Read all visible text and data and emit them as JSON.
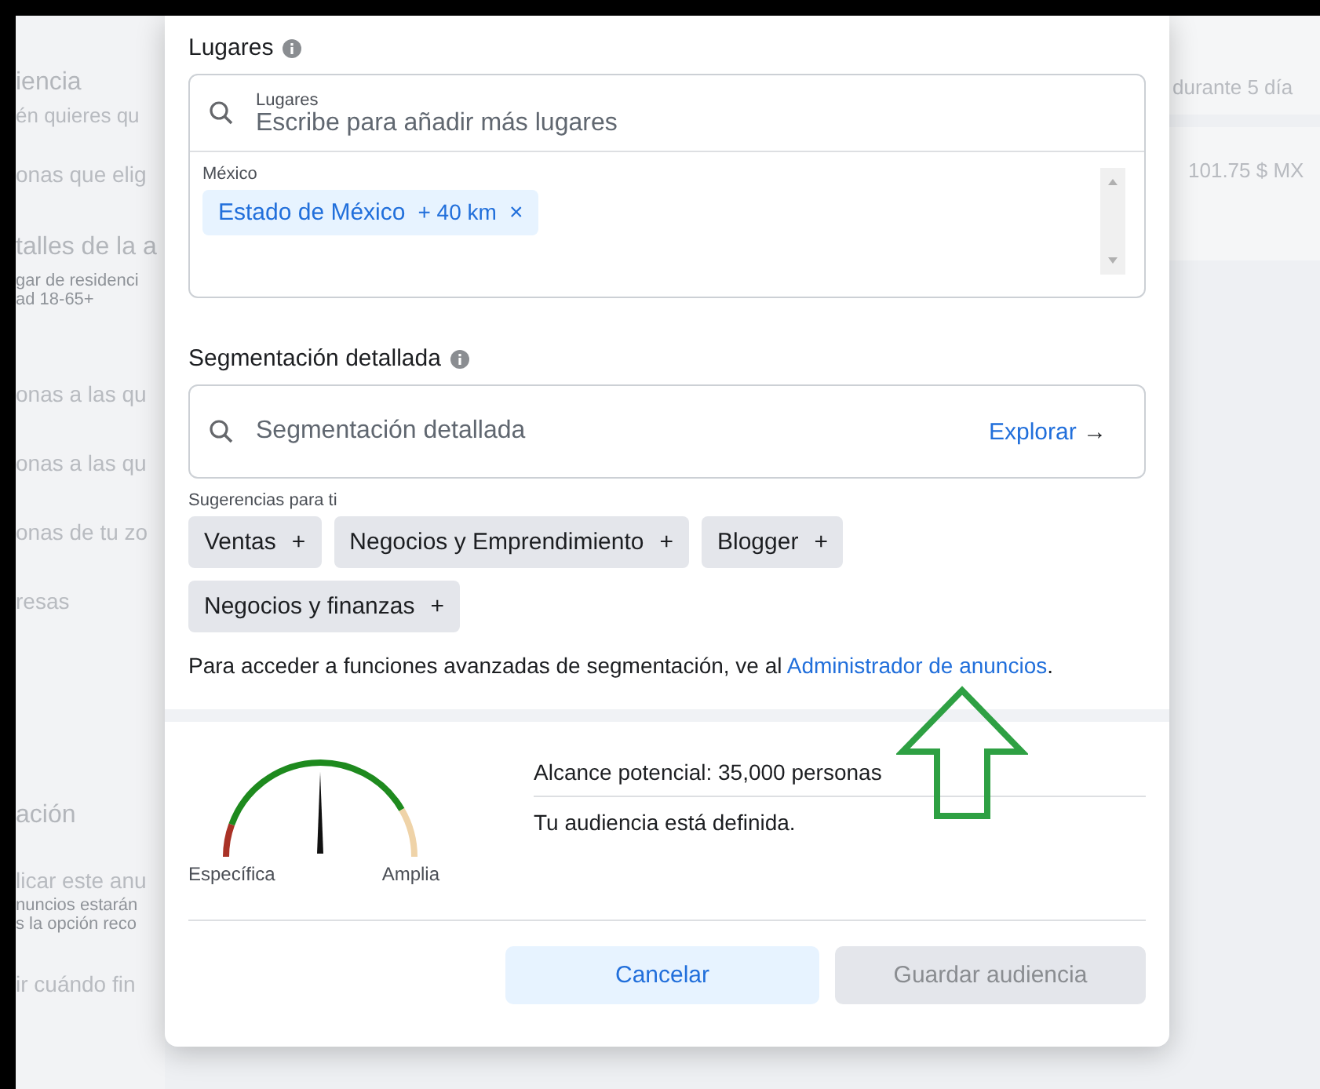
{
  "background": {
    "left_texts": [
      {
        "text": "iencia",
        "kind": "heading"
      },
      {
        "text": "én quieres qu",
        "kind": "sub"
      },
      {
        "text": "onas que elig",
        "kind": "row"
      },
      {
        "text": "talles de la a",
        "kind": "heading"
      },
      {
        "text": "gar de residenci",
        "kind": "small"
      },
      {
        "text": "ad 18-65+",
        "kind": "small"
      },
      {
        "text": "onas a las qu",
        "kind": "row"
      },
      {
        "text": "onas a las qu",
        "kind": "row"
      },
      {
        "text": "onas de tu zo",
        "kind": "row"
      },
      {
        "text": "resas",
        "kind": "row"
      },
      {
        "text": "ación",
        "kind": "heading"
      },
      {
        "text": "licar este anu",
        "kind": "row"
      },
      {
        "text": "nuncios estarán",
        "kind": "small"
      },
      {
        "text": "s la opción reco",
        "kind": "small"
      },
      {
        "text": "ir cuándo fin",
        "kind": "row"
      }
    ],
    "right_texts": [
      "durante 5 día",
      "101.75 $ MX"
    ]
  },
  "modal": {
    "places": {
      "title": "Lugares",
      "field_label": "Lugares",
      "placeholder": "Escribe para añadir más lugares",
      "country": "México",
      "chips": [
        {
          "label": "Estado de México",
          "radius": "+ 40 km",
          "remove": "×"
        }
      ]
    },
    "detailed": {
      "title": "Segmentación detallada",
      "placeholder": "Segmentación detallada",
      "explore": "Explorar",
      "explore_arrow": "→"
    },
    "suggestions": {
      "title": "Sugerencias para ti",
      "chips": [
        {
          "label": "Ventas",
          "add": "+"
        },
        {
          "label": "Negocios y Emprendimiento",
          "add": "+"
        },
        {
          "label": "Blogger",
          "add": "+"
        },
        {
          "label": "Negocios y finanzas",
          "add": "+"
        }
      ]
    },
    "note": {
      "text": "Para acceder a funciones avanzadas de segmentación, ve al ",
      "link": "Administrador de anuncios",
      "end": "."
    },
    "gauge": {
      "left_label": "Específica",
      "right_label": "Amplia"
    },
    "reach": "Alcance potencial: 35,000 personas",
    "status": "Tu audiencia está definida.",
    "buttons": [
      {
        "label": "Cancelar",
        "disabled": false
      },
      {
        "label": "Guardar audiencia",
        "disabled": true
      }
    ]
  }
}
